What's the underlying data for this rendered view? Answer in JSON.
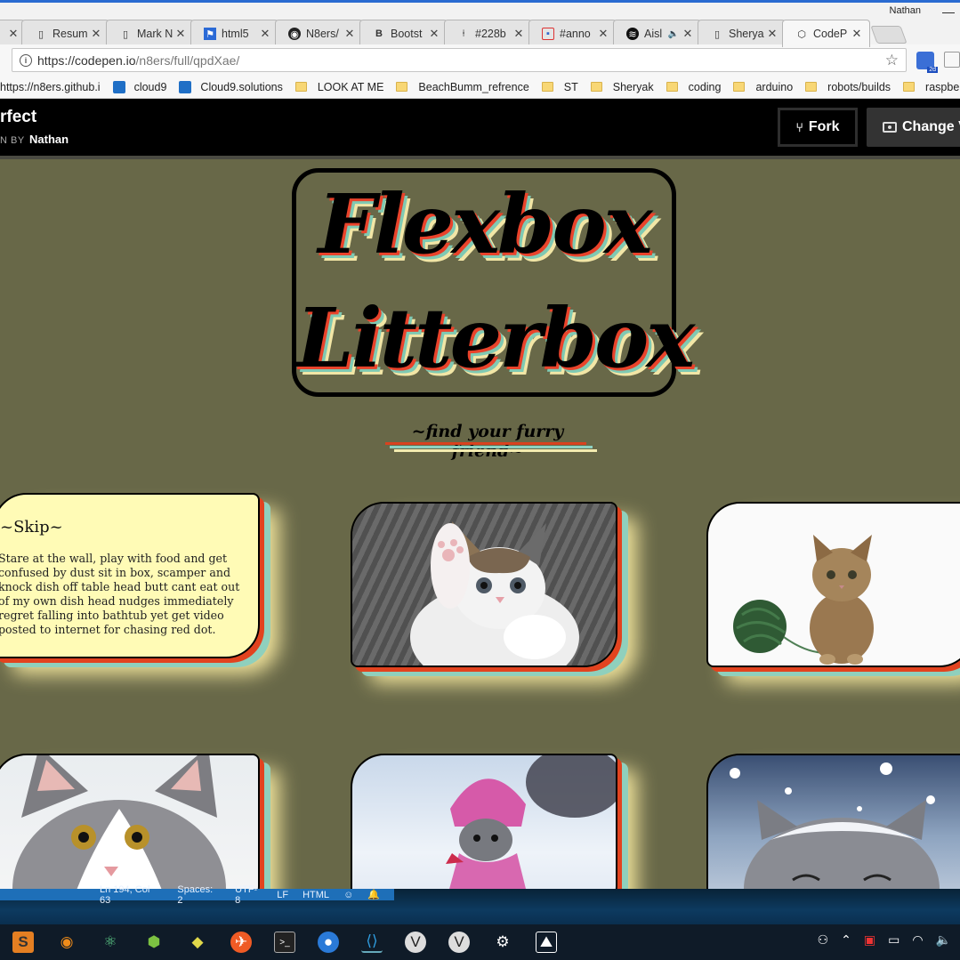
{
  "browser": {
    "tabs": [
      {
        "title": "",
        "icon": "page-icon"
      },
      {
        "title": "Resum",
        "icon": "page-icon"
      },
      {
        "title": "Mark N",
        "icon": "page-icon"
      },
      {
        "title": "html5",
        "icon": "flag-icon"
      },
      {
        "title": "N8ers/",
        "icon": "github-icon"
      },
      {
        "title": "Bootst",
        "icon": "bootstrap-icon"
      },
      {
        "title": "#228b",
        "icon": "pin-icon"
      },
      {
        "title": "#anno",
        "icon": "calendar-icon"
      },
      {
        "title": "Aisl",
        "icon": "spotify-icon"
      },
      {
        "title": "Sherya",
        "icon": "page-icon"
      },
      {
        "title": "CodeP",
        "icon": "codepen-icon"
      }
    ],
    "close_glyph": "✕",
    "profile_name": "Nathan",
    "url_prefix": "https://codepen.io",
    "url_path": "/n8ers/full/qpdXae/",
    "bookmarks": [
      {
        "label": "https://n8ers.github.i",
        "icon": "page"
      },
      {
        "label": "cloud9",
        "icon": "c9"
      },
      {
        "label": "Cloud9.solutions",
        "icon": "c9"
      },
      {
        "label": "LOOK AT ME",
        "icon": "folder"
      },
      {
        "label": "BeachBumm_refrence",
        "icon": "folder"
      },
      {
        "label": "ST",
        "icon": "folder"
      },
      {
        "label": "Sheryak",
        "icon": "folder"
      },
      {
        "label": "coding",
        "icon": "folder"
      },
      {
        "label": "arduino",
        "icon": "folder"
      },
      {
        "label": "robots/builds",
        "icon": "folder"
      },
      {
        "label": "raspberry pi",
        "icon": "folder"
      }
    ]
  },
  "codepen": {
    "pen_title": "rfect",
    "by_label": "N BY",
    "author": "Nathan",
    "fork_label": "Fork",
    "change_view_label": "Change Vi"
  },
  "page": {
    "logo_line1": "Flexbox",
    "logo_line2": "Litterbox",
    "tagline": "~find your furry friend~",
    "cards": [
      {
        "title": "~Skip~",
        "body": "Stare at the wall, play with food and get confused by dust sit in box, scamper and knock dish off table head butt cant eat out of my own dish head nudges immediately regret falling into bathtub yet get video posted to internet for chasing red dot."
      }
    ]
  },
  "statusbar": {
    "position": "Ln 194, Col 63",
    "spaces": "Spaces: 2",
    "encoding": "UTF-8",
    "eol": "LF",
    "language": "HTML"
  },
  "taskbar": {
    "apps": [
      "sublime-icon",
      "blender-icon",
      "atom-icon",
      "nodejs-icon",
      "gitkraken-icon",
      "postman-icon",
      "terminal-icon",
      "firefox-icon",
      "vscode-icon",
      "vivaldi-icon",
      "vivaldi-icon",
      "settings-icon",
      "photos-icon"
    ]
  },
  "colors": {
    "page_bg": "#686848",
    "card_bg": "#fffbb6",
    "shadow_red": "#e2431f",
    "shadow_teal": "#8fd0bd",
    "shadow_cream": "#f0e39b"
  }
}
